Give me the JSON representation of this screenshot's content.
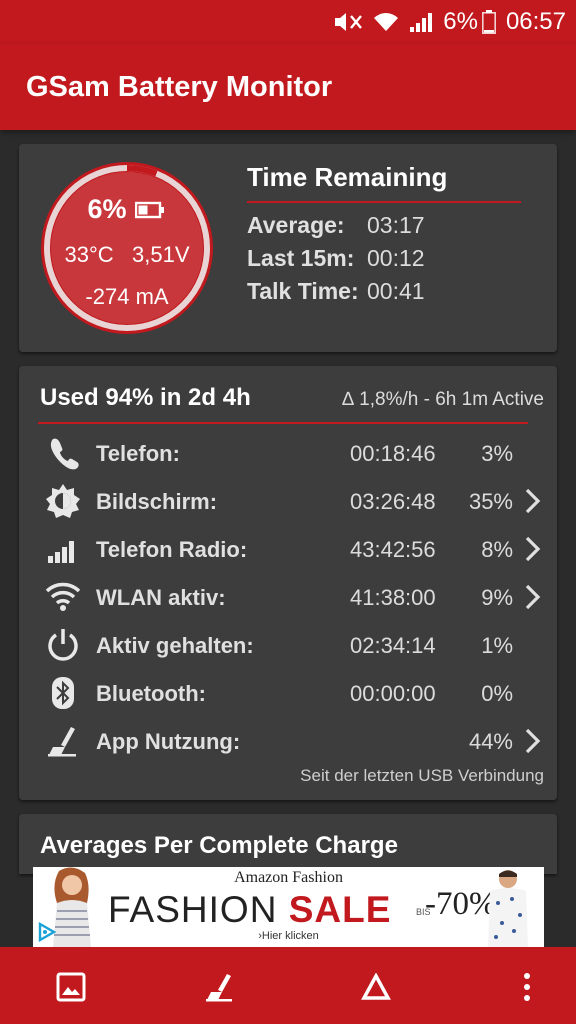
{
  "status_bar": {
    "battery_percent": "6%",
    "time": "06:57",
    "icons": [
      "mute-icon",
      "wifi-icon",
      "signal-icon",
      "battery-icon"
    ]
  },
  "app_bar": {
    "title": "GSam Battery Monitor"
  },
  "battery_card": {
    "percent": "6%",
    "level_fraction": 0.06,
    "temperature": "33°C",
    "voltage": "3,51V",
    "current": "-274 mA",
    "time_remaining": {
      "title": "Time Remaining",
      "rows": [
        {
          "label": "Average:",
          "value": "03:17"
        },
        {
          "label": "Last 15m:",
          "value": "00:12"
        },
        {
          "label": "Talk Time:",
          "value": "00:41"
        }
      ]
    }
  },
  "usage_card": {
    "title": "Used 94% in 2d 4h",
    "rate": "∆ 1,8%/h - 6h 1m Active",
    "rows": [
      {
        "icon": "phone-icon",
        "name": "Telefon:",
        "time": "00:18:46",
        "percent": "3%",
        "chevron": false
      },
      {
        "icon": "brightness-icon",
        "name": "Bildschirm:",
        "time": "03:26:48",
        "percent": "35%",
        "chevron": true
      },
      {
        "icon": "signal-bars-icon",
        "name": "Telefon Radio:",
        "time": "43:42:56",
        "percent": "8%",
        "chevron": true
      },
      {
        "icon": "wifi-icon",
        "name": "WLAN aktiv:",
        "time": "41:38:00",
        "percent": "9%",
        "chevron": true
      },
      {
        "icon": "power-icon",
        "name": "Aktiv gehalten:",
        "time": "02:34:14",
        "percent": "1%",
        "chevron": false
      },
      {
        "icon": "bluetooth-icon",
        "name": "Bluetooth:",
        "time": "00:00:00",
        "percent": "0%",
        "chevron": false
      },
      {
        "icon": "app-usage-icon",
        "name": "App Nutzung:",
        "time": "",
        "percent": "44%",
        "chevron": true
      }
    ],
    "since": "Seit der letzten USB Verbindung"
  },
  "averages_card": {
    "title": "Averages Per Complete Charge"
  },
  "ad": {
    "brand": "Amazon Fashion",
    "headline_1": "FASHION",
    "headline_2": "SALE",
    "prefix": "BIS",
    "discount": "-70%",
    "link": "›Hier klicken"
  },
  "bottom_bar": {
    "buttons": [
      "image-icon",
      "app-usage-icon",
      "delta-icon",
      "overflow-menu-icon"
    ]
  },
  "colors": {
    "accent": "#c1191e",
    "card": "#3d3d3d",
    "background": "#2b2b2b"
  }
}
